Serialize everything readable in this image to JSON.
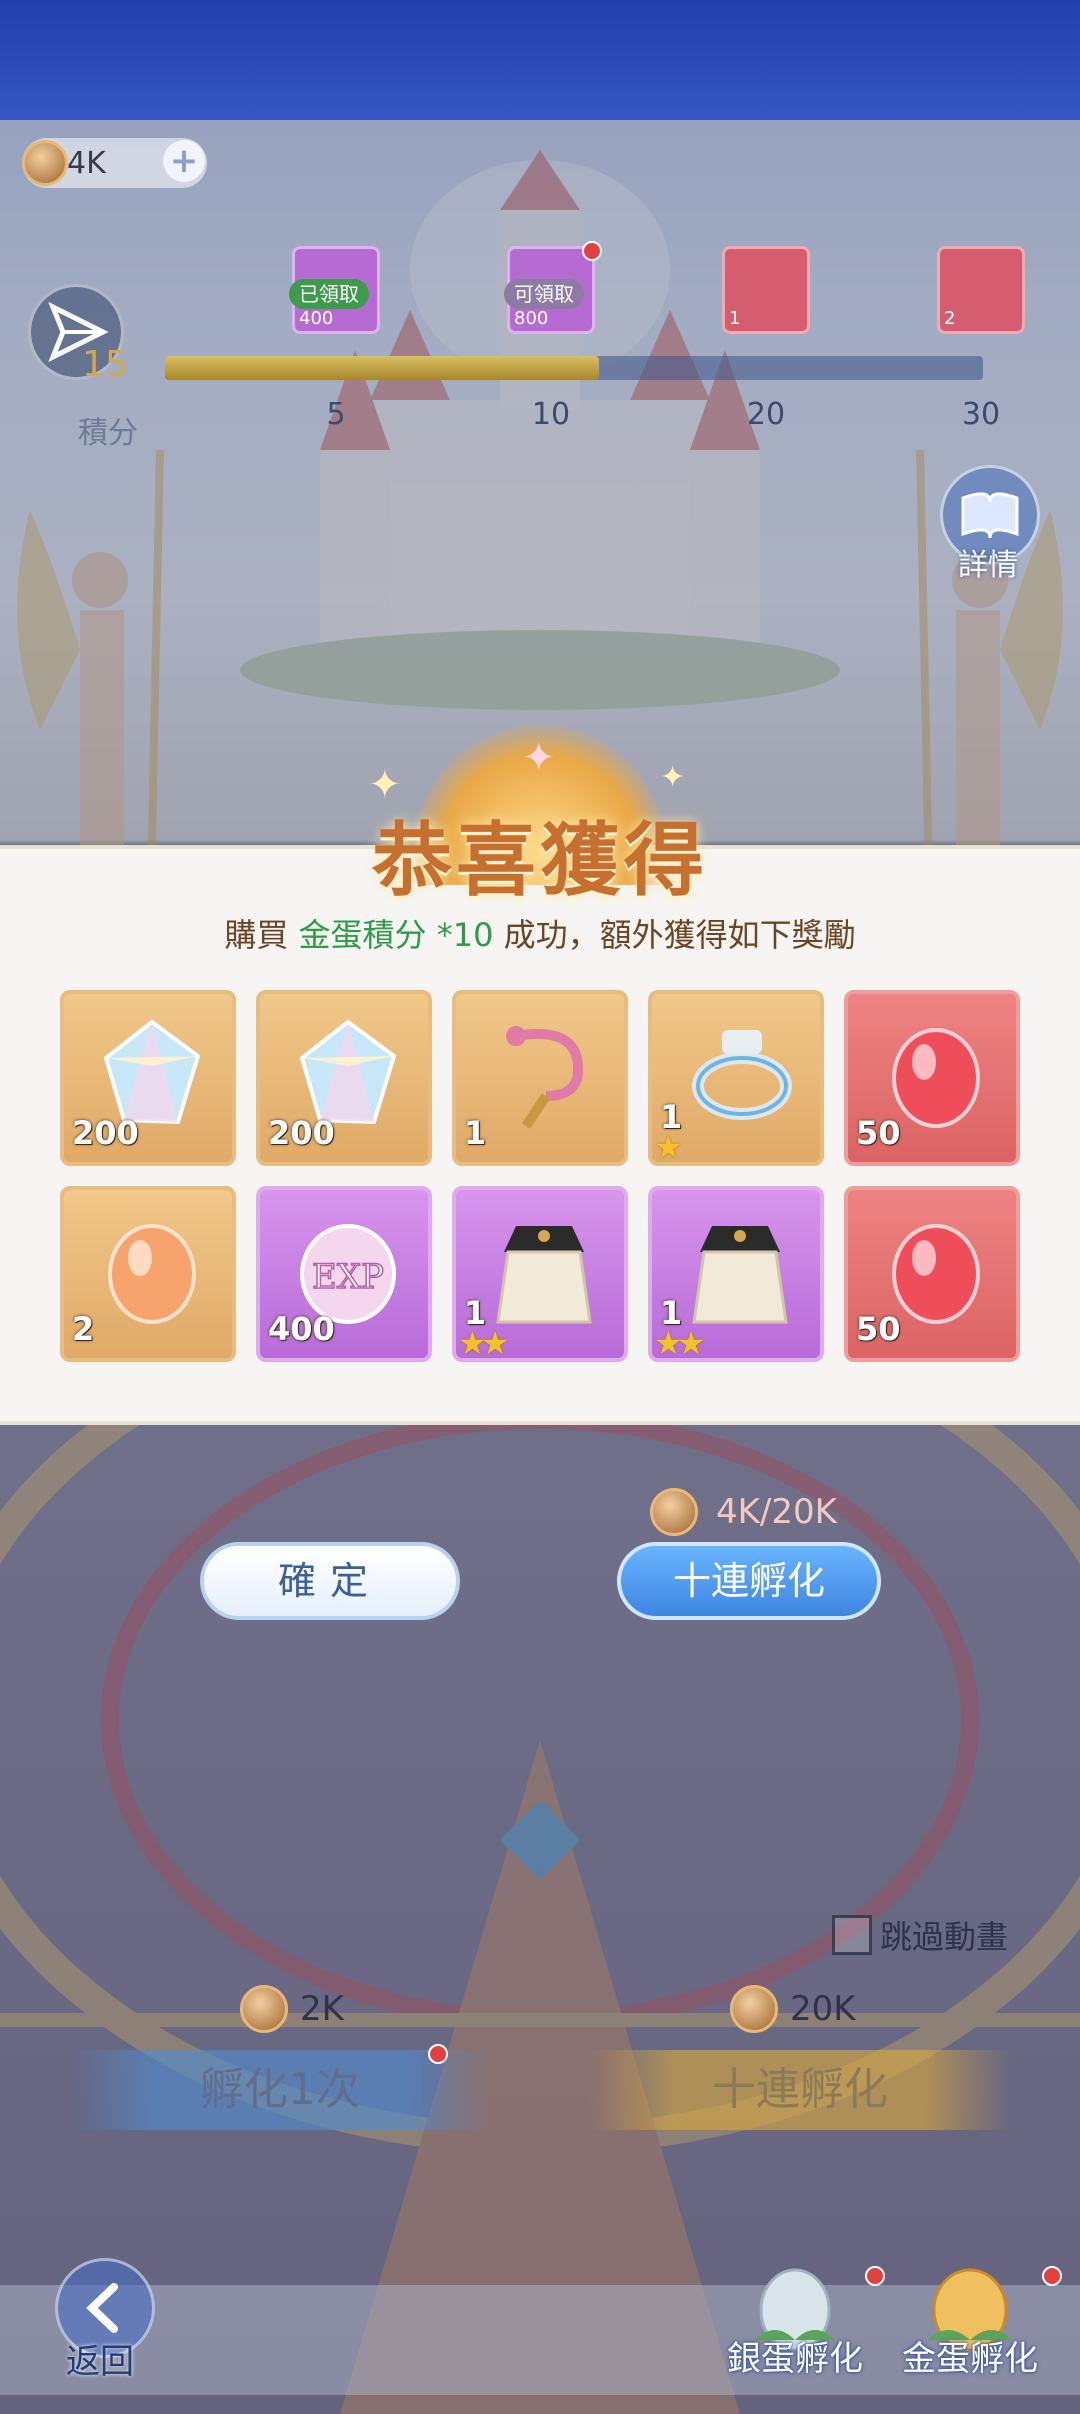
{
  "currency": {
    "amount": "4K"
  },
  "score": {
    "value": "15",
    "label": "積分",
    "progress_fraction": 0.53
  },
  "milestones": [
    {
      "value": "5",
      "status": "已領取",
      "qty": "400"
    },
    {
      "value": "10",
      "status": "可領取",
      "qty": "800"
    },
    {
      "value": "20",
      "status": "",
      "qty": "1"
    },
    {
      "value": "30",
      "status": "",
      "qty": "2"
    }
  ],
  "detail_label": "詳情",
  "popup": {
    "title": "恭喜獲得",
    "message_prefix": "購買",
    "message_highlight": "金蛋積分 *10",
    "message_suffix": "成功，額外獲得如下獎勵",
    "items": [
      {
        "icon": "crystal-icon",
        "qty": "200",
        "stars": 0,
        "bg": "gold"
      },
      {
        "icon": "crystal-icon",
        "qty": "200",
        "stars": 0,
        "bg": "gold"
      },
      {
        "icon": "wand-icon",
        "qty": "1",
        "stars": 0,
        "bg": "gold"
      },
      {
        "icon": "ring-icon",
        "qty": "1",
        "stars": 1,
        "bg": "gold"
      },
      {
        "icon": "red-egg-icon",
        "qty": "50",
        "stars": 0,
        "bg": "red"
      },
      {
        "icon": "orange-egg-icon",
        "qty": "2",
        "stars": 0,
        "bg": "gold"
      },
      {
        "icon": "exp-egg-icon",
        "qty": "400",
        "stars": 0,
        "bg": "purple"
      },
      {
        "icon": "cape-icon",
        "qty": "1",
        "stars": 2,
        "bg": "purple"
      },
      {
        "icon": "cape-icon",
        "qty": "1",
        "stars": 2,
        "bg": "purple"
      },
      {
        "icon": "red-egg-icon",
        "qty": "50",
        "stars": 0,
        "bg": "red"
      }
    ],
    "cost": "4K/20K",
    "confirm_label": "確定",
    "ten_label": "十連孵化"
  },
  "skip_label": "跳過動畫",
  "hatch": {
    "single_cost": "2K",
    "single_label": "孵化1次",
    "ten_cost": "20K",
    "ten_label": "十連孵化"
  },
  "nav": {
    "back_label": "返回",
    "silver_label": "銀蛋孵化",
    "gold_label": "金蛋孵化"
  },
  "colors": {
    "highlight": "#2f9a4a",
    "title": "#c66f2f",
    "ten_button": "#3f85e2"
  }
}
